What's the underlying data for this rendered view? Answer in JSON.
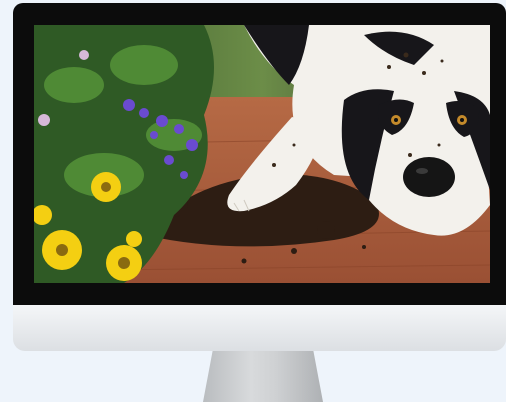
{
  "scene": {
    "subject": "black-and-white-dog",
    "setting": "wooden-deck-with-spilled-soil-and-flowers",
    "flowers": [
      "yellow-daisies",
      "purple-lobelia"
    ]
  },
  "colors": {
    "deck": "#a3593b",
    "soil": "#2d1d13",
    "dog_white": "#f3f1ec",
    "dog_black": "#17161a",
    "daisy": "#f4cf12",
    "lobelia": "#6a4bd0",
    "bezel": "#0c0c0c",
    "background": "#eef4fb"
  }
}
